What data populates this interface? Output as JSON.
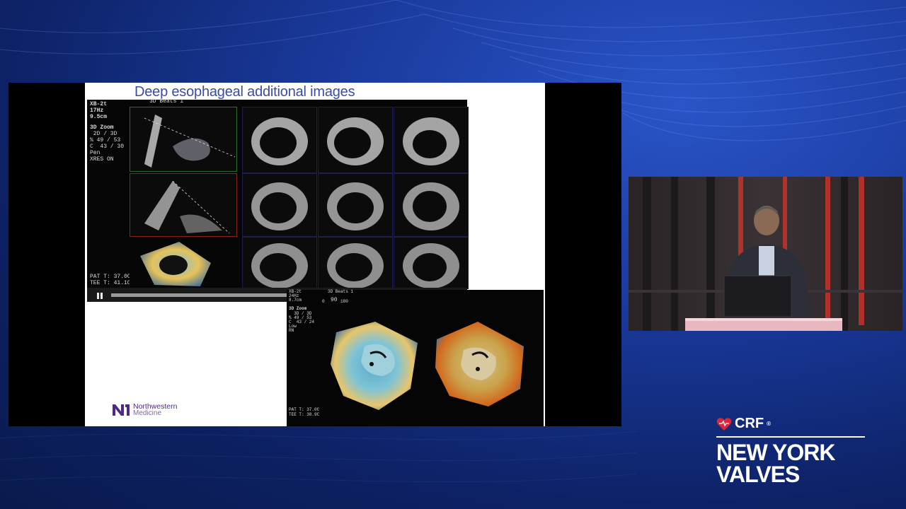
{
  "slide": {
    "title": "Deep esophageal additional images",
    "logo_line1": "Northwestern",
    "logo_line2": "Medicine"
  },
  "echo": {
    "header": "XB-2t\n17Hz\n9.5cm",
    "zoom_label": "3D Zoom",
    "zoom_settings": " 2D / 3D\n% 49 / 53\nC  43 / 30\nPen\nXRES ON",
    "panel_title": "3D Beats 1",
    "temps": "PAT T: 37.0C\nTEE T: 41.1C",
    "pause_icon": "pause-icon",
    "volume_icon": "speaker-icon"
  },
  "echo3d": {
    "header": "XB-2t\n24Hz\n8.7cm",
    "panel_title": "3D Beats 1",
    "zoom_label": "3D Zoom",
    "zoom_settings": "  3D / 3D\n% 49 / 53\nC  43 / 24\nLow\nRN",
    "angle_value": "90",
    "angle_left": "0",
    "angle_right": "180",
    "temps": "PAT T: 37.0C\nTEE T: 38.9C"
  },
  "brand": {
    "crf": "CRF",
    "reg": "®",
    "line1": "NEW YORK",
    "line2": "VALVES"
  },
  "colors": {
    "title_blue": "#3b4da0",
    "northwestern_purple": "#4e2a84",
    "brand_red": "#e0243a"
  }
}
